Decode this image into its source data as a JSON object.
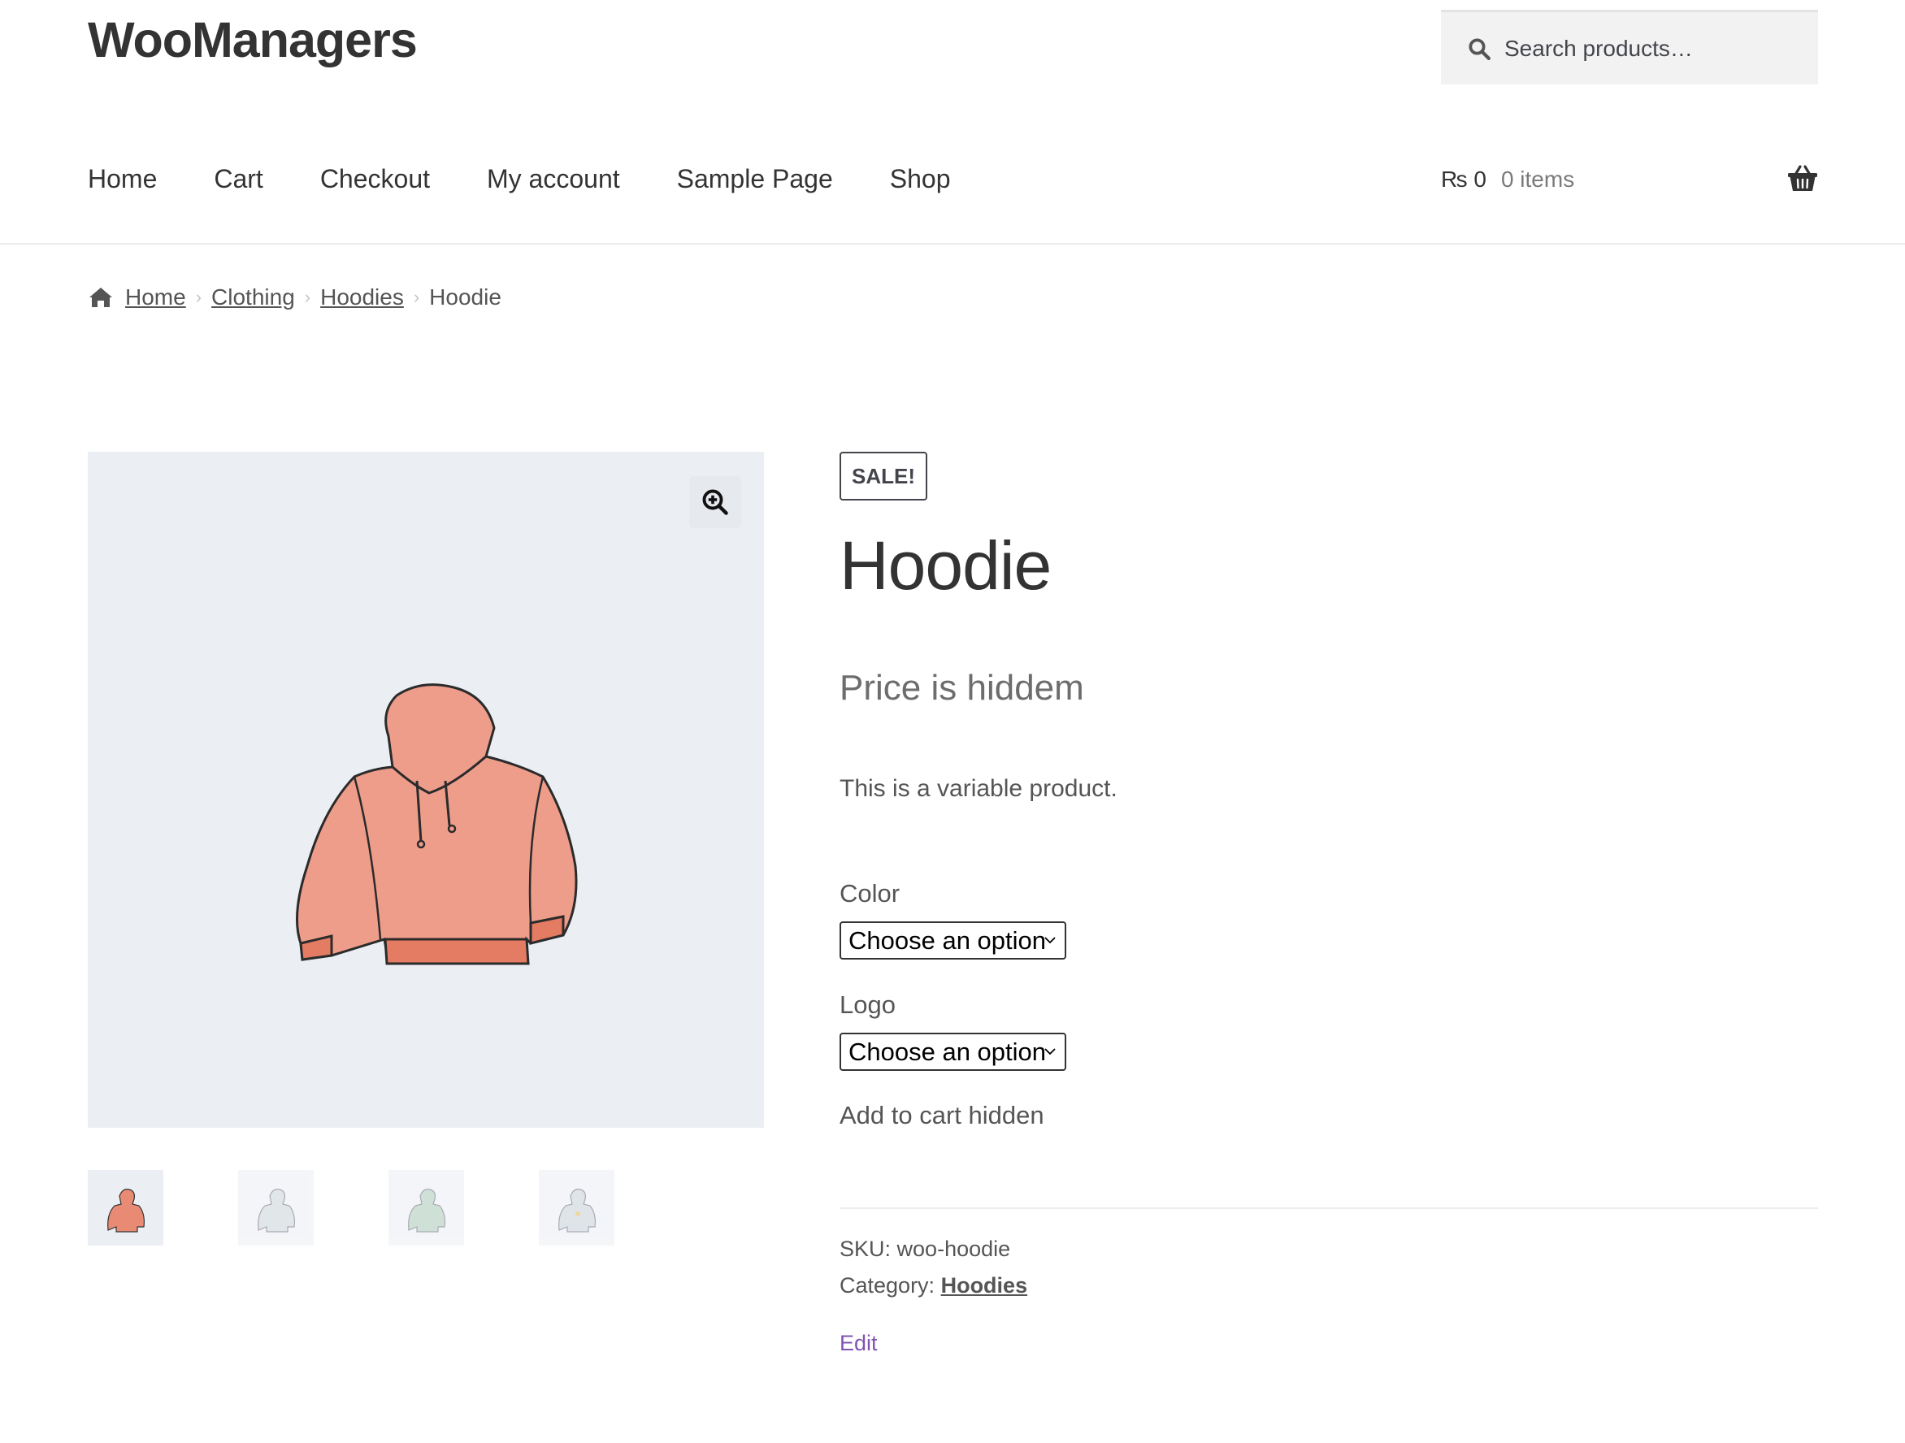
{
  "site": {
    "title": "WooManagers"
  },
  "search": {
    "placeholder": "Search products…",
    "icon": "search-icon"
  },
  "nav": {
    "items": [
      {
        "label": "Home"
      },
      {
        "label": "Cart"
      },
      {
        "label": "Checkout"
      },
      {
        "label": "My account"
      },
      {
        "label": "Sample Page"
      },
      {
        "label": "Shop"
      }
    ]
  },
  "cart": {
    "amount": "₨ 0",
    "count": "0 items",
    "icon": "basket-icon"
  },
  "breadcrumb": {
    "items": [
      {
        "label": "Home"
      },
      {
        "label": "Clothing"
      },
      {
        "label": "Hoodies"
      }
    ],
    "current": "Hoodie"
  },
  "product": {
    "sale_badge": "SALE!",
    "title": "Hoodie",
    "price_text": "Price is hiddem",
    "short_description": "This is a variable product.",
    "variations": [
      {
        "label": "Color",
        "selected": "Choose an option"
      },
      {
        "label": "Logo",
        "selected": "Choose an option"
      }
    ],
    "add_to_cart_text": "Add to cart hidden",
    "sku_label": "SKU:",
    "sku_value": "woo-hoodie",
    "category_label": "Category:",
    "category_value": "Hoodies",
    "edit_label": "Edit"
  },
  "gallery": {
    "thumbnail_colors": [
      "#e98b74",
      "#c9d3d6",
      "#a9c9b8",
      "#c5ced8"
    ]
  },
  "colors": {
    "accent_link": "#7f54b3",
    "image_background": "#ebeef3",
    "hoodie_main": "#ef9d8b"
  }
}
